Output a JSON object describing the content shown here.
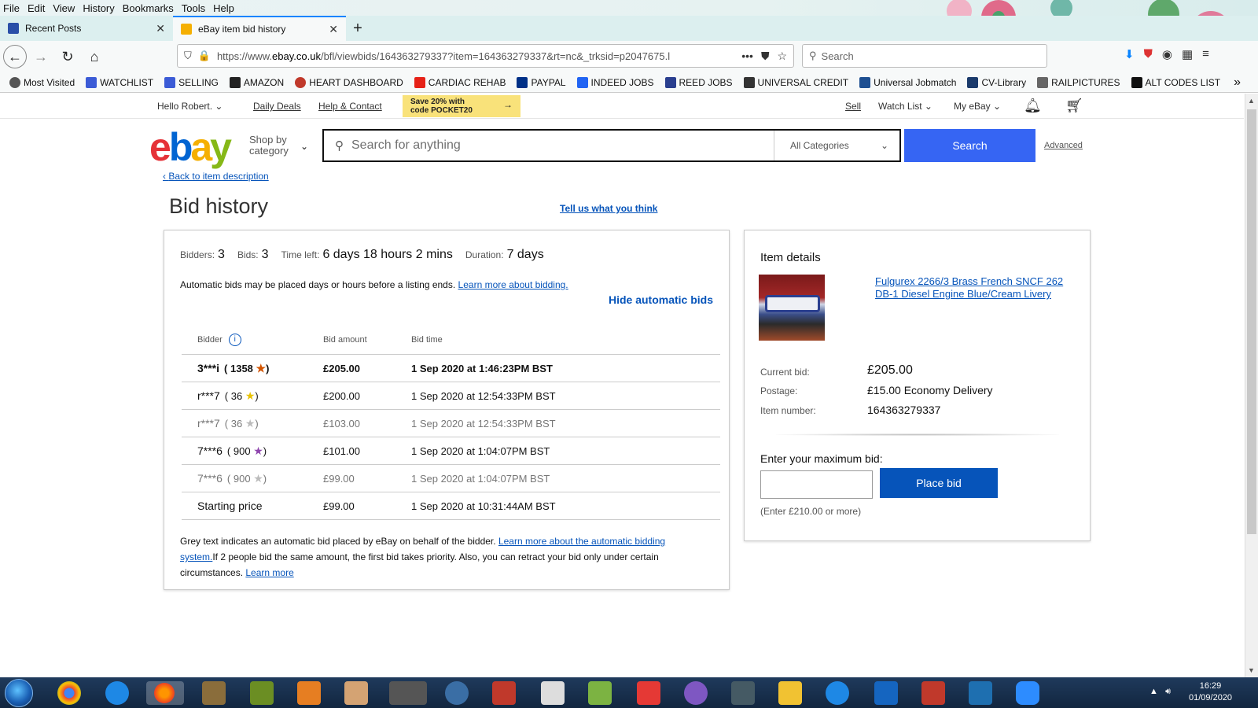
{
  "browser": {
    "menu": [
      "File",
      "Edit",
      "View",
      "History",
      "Bookmarks",
      "Tools",
      "Help"
    ],
    "tabs": [
      {
        "title": "Recent Posts",
        "close": "✕"
      },
      {
        "title": "eBay item bid history",
        "close": "✕"
      }
    ],
    "new_tab": "+",
    "url_prefix": "https://www.",
    "url_domain": "ebay.co.uk",
    "url_rest": "/bfl/viewbids/164363279337?item=164363279337&rt=nc&_trksid=p2047675.l",
    "search_placeholder": "Search",
    "bookmarks": [
      {
        "label": "Most Visited",
        "color": "#555555"
      },
      {
        "label": "WATCHLIST",
        "color": "#3b5bd6"
      },
      {
        "label": "SELLING",
        "color": "#3b5bd6"
      },
      {
        "label": "AMAZON",
        "color": "#222222"
      },
      {
        "label": "HEART DASHBOARD",
        "color": "#c0392b"
      },
      {
        "label": "CARDIAC REHAB",
        "color": "#e62117"
      },
      {
        "label": "PAYPAL",
        "color": "#003087"
      },
      {
        "label": "INDEED JOBS",
        "color": "#2164f3"
      },
      {
        "label": "REED JOBS",
        "color": "#2a3f8f"
      },
      {
        "label": "UNIVERSAL CREDIT",
        "color": "#333333"
      },
      {
        "label": "Universal Jobmatch",
        "color": "#1d4f91"
      },
      {
        "label": "CV-Library",
        "color": "#1a3a6b"
      },
      {
        "label": "RAILPICTURES",
        "color": "#666666"
      },
      {
        "label": "ALT CODES LIST",
        "color": "#111111"
      }
    ],
    "overflow": "»"
  },
  "ebay": {
    "greeting": "Hello Robert.",
    "daily_deals": "Daily Deals",
    "help": "Help & Contact",
    "promo_line1": "Save 20% with",
    "promo_line2": "code POCKET20",
    "promo_arrow": "→",
    "sell": "Sell",
    "watch_list": "Watch List",
    "my_ebay": "My eBay",
    "shop_by_category_1": "Shop by",
    "shop_by_category_2": "category",
    "search_placeholder": "Search for anything",
    "all_categories": "All Categories",
    "search_button": "Search",
    "advanced": "Advanced",
    "back_link": "Back to item description",
    "page_title": "Bid history",
    "tell_us": "Tell us what you think"
  },
  "bid_history": {
    "bidders_label": "Bidders:",
    "bidders": "3",
    "bids_label": "Bids:",
    "bids": "3",
    "time_left_label": "Time left:",
    "time_left": "6 days 18 hours 2 mins",
    "duration_label": "Duration:",
    "duration": "7 days",
    "auto_note": "Automatic bids may be placed days or hours before a listing ends.",
    "auto_note_link": "Learn more about bidding.",
    "hide_auto": "Hide automatic bids",
    "columns": {
      "bidder": "Bidder",
      "amount": "Bid amount",
      "time": "Bid time"
    },
    "rows": [
      {
        "bidder": "3***i",
        "score": "1358",
        "star_color": "#d35400",
        "amount": "£205.00",
        "time": "1 Sep 2020 at 1:46:23PM BST",
        "style": "bold"
      },
      {
        "bidder": "r***7",
        "score": "36",
        "star_color": "#e8c200",
        "amount": "£200.00",
        "time": "1 Sep 2020 at 12:54:33PM BST",
        "style": "normal"
      },
      {
        "bidder": "r***7",
        "score": "36",
        "star_color": "#bbbbbb",
        "amount": "£103.00",
        "time": "1 Sep 2020 at 12:54:33PM BST",
        "style": "grey"
      },
      {
        "bidder": "7***6",
        "score": "900",
        "star_color": "#8e44ad",
        "amount": "£101.00",
        "time": "1 Sep 2020 at 1:04:07PM BST",
        "style": "normal"
      },
      {
        "bidder": "7***6",
        "score": "900",
        "star_color": "#bbbbbb",
        "amount": "£99.00",
        "time": "1 Sep 2020 at 1:04:07PM BST",
        "style": "grey"
      },
      {
        "bidder": "Starting price",
        "score": "",
        "star_color": "",
        "amount": "£99.00",
        "time": "1 Sep 2020 at 10:31:44AM BST",
        "style": "normal"
      }
    ],
    "footnote_1": "Grey text indicates an automatic bid placed by eBay on behalf of the bidder.",
    "footnote_link_1": "Learn more about the automatic bidding system.",
    "footnote_2": "If 2 people bid the same amount, the first bid takes priority. Also, you can retract your bid only under certain circumstances.",
    "footnote_link_2": "Learn more"
  },
  "item_details": {
    "title": "Item details",
    "item_link": "Fulgurex 2266/3 Brass French SNCF 262 DB-1 Diesel Engine Blue/Cream Livery",
    "current_bid_label": "Current bid:",
    "current_bid": "£205.00",
    "postage_label": "Postage:",
    "postage": "£15.00 Economy Delivery",
    "item_number_label": "Item number:",
    "item_number": "164363279337",
    "max_bid_label": "Enter your maximum bid:",
    "place_bid": "Place bid",
    "enter_hint": "(Enter £210.00 or more)"
  },
  "taskbar": {
    "time": "16:29",
    "date": "01/09/2020"
  }
}
